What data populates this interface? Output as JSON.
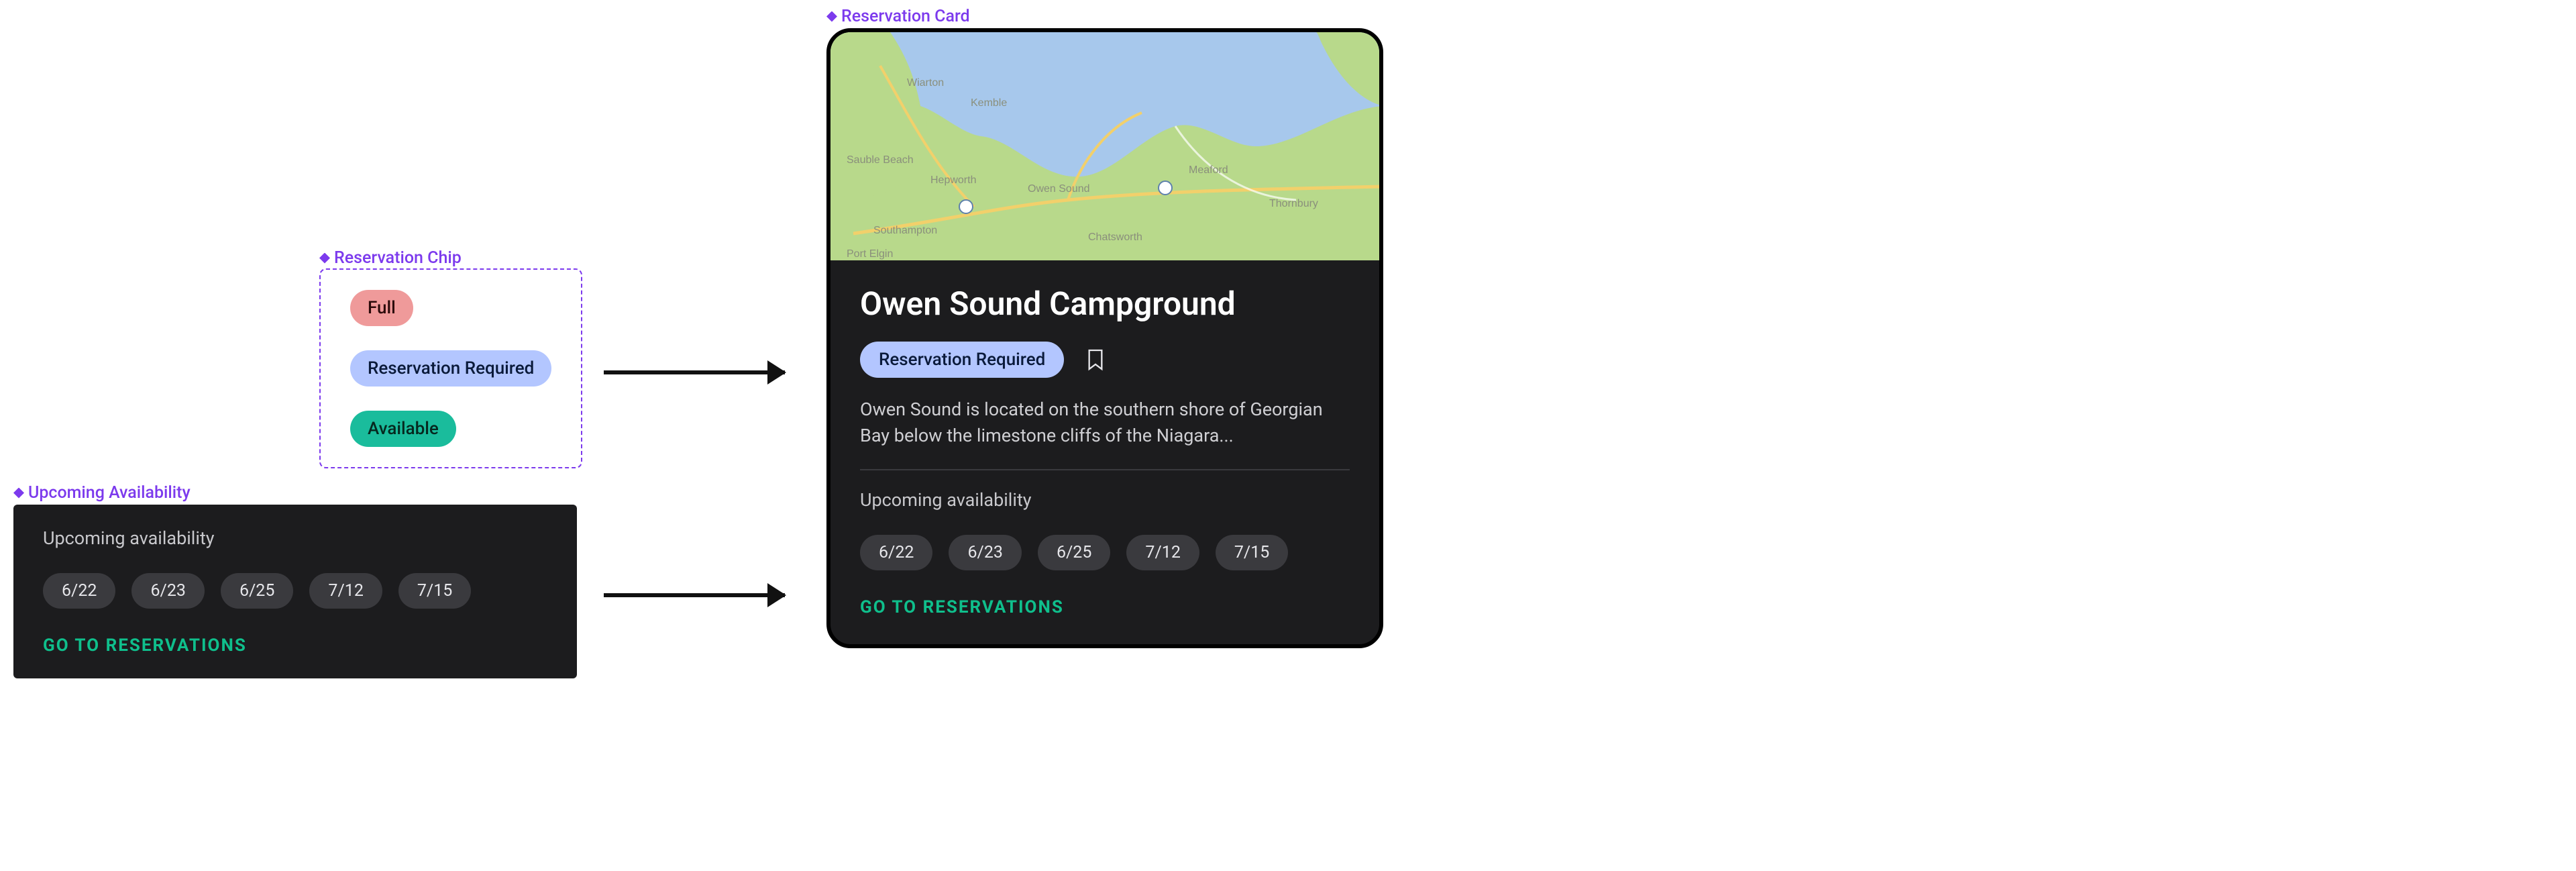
{
  "labels": {
    "chip_component": "Reservation Chip",
    "availability_component": "Upcoming Availability",
    "card_component": "Reservation Card"
  },
  "chips": {
    "full": "Full",
    "reservation": "Reservation Required",
    "available": "Available"
  },
  "availability": {
    "title": "Upcoming availability",
    "dates": [
      "6/22",
      "6/23",
      "6/25",
      "7/12",
      "7/15"
    ],
    "cta": "GO TO RESERVATIONS"
  },
  "card": {
    "title": "Owen Sound Campground",
    "status": "Reservation Required",
    "description": "Owen Sound is located on the southern shore of Georgian Bay below the limestone cliffs of the Niagara...",
    "availability_title": "Upcoming availability",
    "dates": [
      "6/22",
      "6/23",
      "6/25",
      "7/12",
      "7/15"
    ],
    "cta": "GO TO RESERVATIONS",
    "map_places": [
      "Wiarton",
      "Kemble",
      "Sauble Beach",
      "Hepworth",
      "Owen Sound",
      "Meaford",
      "Thornbury",
      "Southampton",
      "Chatsworth",
      "Port Elgin"
    ]
  },
  "colors": {
    "purple": "#7c3aed",
    "red_chip": "#ef9a9a",
    "blue_chip": "#b3c6ff",
    "green_chip": "#1abc9c",
    "dark_panel": "#1c1c1e",
    "cta_green": "#0fbf8c"
  }
}
